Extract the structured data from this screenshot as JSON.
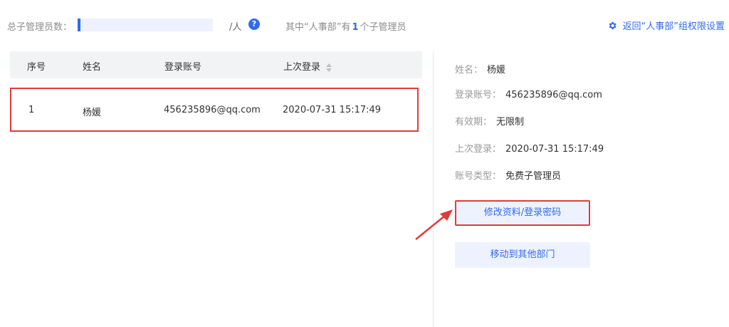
{
  "top": {
    "total_label": "总子管理员数：",
    "unit": "/人",
    "summary_prefix": "其中“人事部”有",
    "summary_count": "1",
    "summary_suffix": "个子管理员",
    "back_link": "返回“人事部”组权限设置"
  },
  "table": {
    "headers": [
      "序号",
      "姓名",
      "登录账号",
      "上次登录"
    ],
    "rows": [
      {
        "index": "1",
        "name": "杨媛",
        "account": "456235896@qq.com",
        "last_login": "2020-07-31 15:17:49"
      }
    ]
  },
  "detail": {
    "name_label": "姓名：",
    "name_value": "杨媛",
    "account_label": "登录账号：",
    "account_value": "456235896@qq.com",
    "validity_label": "有效期：",
    "validity_value": "无限制",
    "last_login_label": "上次登录：",
    "last_login_value": "2020-07-31 15:17:49",
    "type_label": "账号类型：",
    "type_value": "免费子管理员"
  },
  "buttons": {
    "edit": "修改资料/登录密码",
    "move": "移动到其他部门"
  },
  "colors": {
    "accent": "#2f6bf0",
    "highlight": "#e23b3b",
    "button_bg": "#eef2ff"
  }
}
